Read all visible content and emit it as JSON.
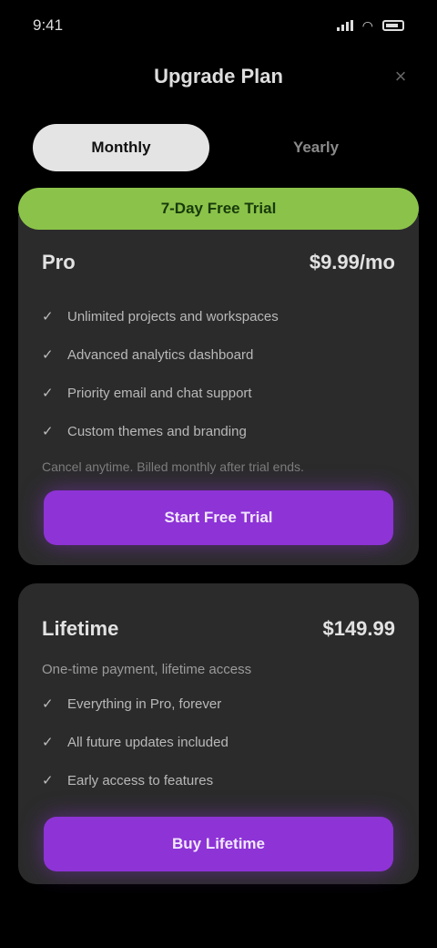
{
  "status_bar": {
    "time": "9:41"
  },
  "header": {
    "title": "Upgrade Plan",
    "close_glyph": "×"
  },
  "tabs": [
    {
      "label": "Monthly",
      "active": true
    },
    {
      "label": "Yearly",
      "active": false
    }
  ],
  "banner": {
    "label": "7-Day Free Trial"
  },
  "plans": [
    {
      "name": "Pro",
      "price": "$9.99/mo",
      "features": [
        "Unlimited projects and workspaces",
        "Advanced analytics dashboard",
        "Priority email and chat support",
        "Custom themes and branding"
      ],
      "fine_print": "Cancel anytime. Billed monthly after trial ends.",
      "cta_label": "Start Free Trial"
    },
    {
      "name": "Lifetime",
      "price": "$149.99",
      "subtitle": "One-time payment, lifetime access",
      "features": [
        "Everything in Pro, forever",
        "All future updates included",
        "Early access to features"
      ],
      "cta_label": "Buy Lifetime"
    }
  ],
  "colors": {
    "accent_green": "#8bc34a",
    "accent_purple": "#8e33d6",
    "card_bg": "#2b2b2b",
    "page_bg": "#000000"
  }
}
